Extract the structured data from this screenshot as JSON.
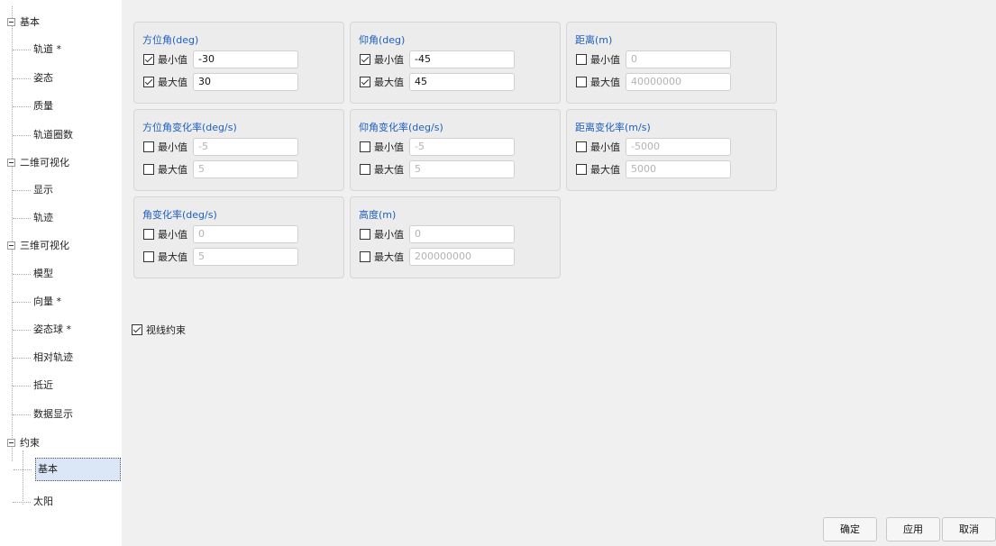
{
  "tree": {
    "groups": [
      {
        "label": "基本",
        "children": [
          "轨道 *",
          "姿态",
          "质量",
          "轨道圈数"
        ]
      },
      {
        "label": "二维可视化",
        "children": [
          "显示",
          "轨迹"
        ]
      },
      {
        "label": "三维可视化",
        "children": [
          "模型",
          "向量 *",
          "姿态球 *",
          "相对轨迹",
          "抵近",
          "数据显示"
        ]
      },
      {
        "label": "约束",
        "children": [
          "基本",
          "太阳"
        ]
      }
    ],
    "selected": "约束 > 基本"
  },
  "min_label": "最小值",
  "max_label": "最大值",
  "constraint_groups": [
    {
      "title": "方位角(deg)",
      "min": {
        "checked": true,
        "value": "-30"
      },
      "max": {
        "checked": true,
        "value": "30"
      }
    },
    {
      "title": "仰角(deg)",
      "min": {
        "checked": true,
        "value": "-45"
      },
      "max": {
        "checked": true,
        "value": "45"
      }
    },
    {
      "title": "距离(m)",
      "min": {
        "checked": false,
        "value": "0"
      },
      "max": {
        "checked": false,
        "value": "40000000"
      }
    },
    {
      "title": "方位角变化率(deg/s)",
      "min": {
        "checked": false,
        "value": "-5"
      },
      "max": {
        "checked": false,
        "value": "5"
      }
    },
    {
      "title": "仰角变化率(deg/s)",
      "min": {
        "checked": false,
        "value": "-5"
      },
      "max": {
        "checked": false,
        "value": "5"
      }
    },
    {
      "title": "距离变化率(m/s)",
      "min": {
        "checked": false,
        "value": "-5000"
      },
      "max": {
        "checked": false,
        "value": "5000"
      }
    },
    {
      "title": "角变化率(deg/s)",
      "min": {
        "checked": false,
        "value": "0"
      },
      "max": {
        "checked": false,
        "value": "5"
      }
    },
    {
      "title": "高度(m)",
      "min": {
        "checked": false,
        "value": "0"
      },
      "max": {
        "checked": false,
        "value": "200000000"
      }
    }
  ],
  "line_of_sight": {
    "label": "视线约束",
    "checked": true
  },
  "buttons": {
    "ok": "确定",
    "apply": "应用",
    "cancel": "取消"
  },
  "colors": {
    "group_title": "#1e5fbf",
    "panel_bg": "#f0f0f0",
    "selected_bg": "#dbe7f7"
  }
}
